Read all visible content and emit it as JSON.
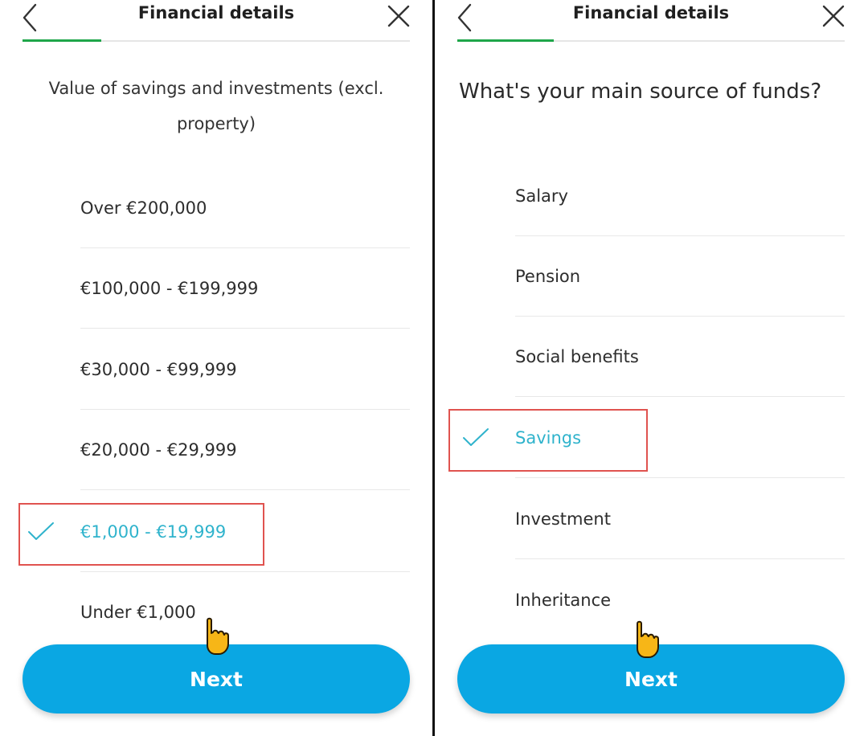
{
  "colors": {
    "accent": "#0aa7e3",
    "selected_text": "#2fb3cc",
    "progress": "#1fa64a",
    "highlight": "#e0534f"
  },
  "left": {
    "header": {
      "title": "Financial details",
      "back_icon": "chevron-left-icon",
      "close_icon": "close-icon"
    },
    "question": "Value of savings and investments (excl. property)",
    "options": [
      {
        "label": "Over €200,000",
        "selected": false
      },
      {
        "label": "€100,000 - €199,999",
        "selected": false
      },
      {
        "label": "€30,000 - €99,999",
        "selected": false
      },
      {
        "label": "€20,000 - €29,999",
        "selected": false
      },
      {
        "label": "€1,000 - €19,999",
        "selected": true
      },
      {
        "label": "Under €1,000",
        "selected": false
      }
    ],
    "next_label": "Next"
  },
  "right": {
    "header": {
      "title": "Financial details",
      "back_icon": "chevron-left-icon",
      "close_icon": "close-icon"
    },
    "question": "What's your main source of funds?",
    "options": [
      {
        "label": "Salary",
        "selected": false
      },
      {
        "label": "Pension",
        "selected": false
      },
      {
        "label": "Social benefits",
        "selected": false
      },
      {
        "label": "Savings",
        "selected": true
      },
      {
        "label": "Investment",
        "selected": false
      },
      {
        "label": "Inheritance",
        "selected": false
      }
    ],
    "next_label": "Next"
  }
}
